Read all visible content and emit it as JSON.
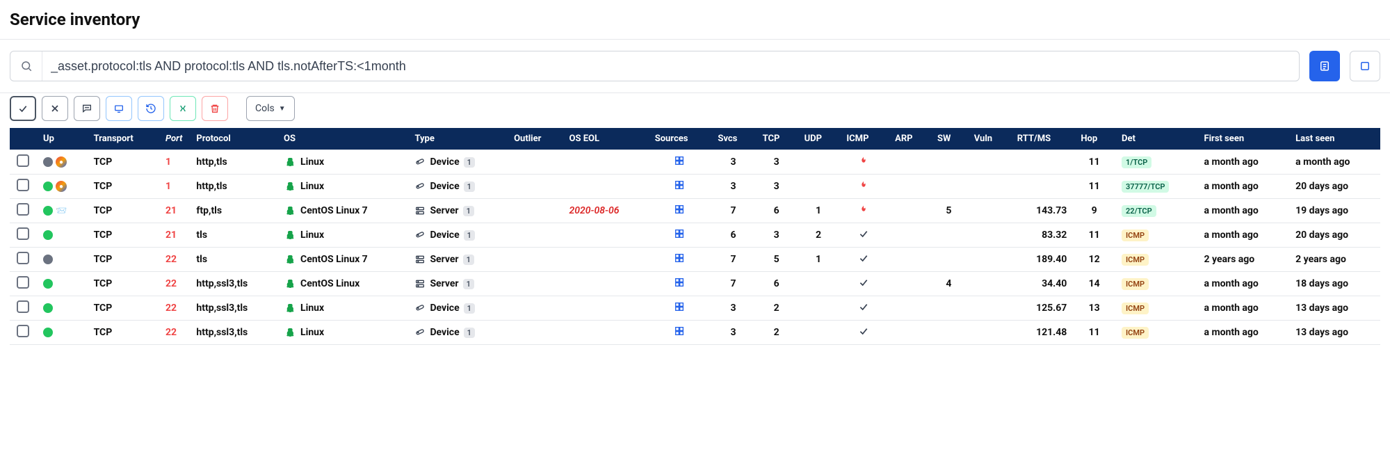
{
  "page": {
    "title": "Service inventory"
  },
  "search": {
    "value": "_asset.protocol:tls AND protocol:tls AND tls.notAfterTS:<1month"
  },
  "toolbar": {
    "cols_label": "Cols"
  },
  "columns": {
    "up": "Up",
    "transport": "Transport",
    "port": "Port",
    "protocol": "Protocol",
    "os": "OS",
    "type": "Type",
    "outlier": "Outlier",
    "os_eol": "OS EOL",
    "sources": "Sources",
    "svcs": "Svcs",
    "tcp": "TCP",
    "udp": "UDP",
    "icmp": "ICMP",
    "arp": "ARP",
    "sw": "SW",
    "vuln": "Vuln",
    "rtt": "RTT/MS",
    "hop": "Hop",
    "det": "Det",
    "first_seen": "First seen",
    "last_seen": "Last seen"
  },
  "rows": [
    {
      "up": "gray",
      "pair": "browser",
      "transport": "TCP",
      "port": "1",
      "protocol": "http,tls",
      "os": "Linux",
      "type": "Device",
      "type_n": "1",
      "outlier": "",
      "eol": "",
      "svcs": "3",
      "tcp": "3",
      "udp": "",
      "icmp": "flame",
      "arp": "",
      "sw": "",
      "vuln": "",
      "rtt": "",
      "hop": "11",
      "det": "1/TCP",
      "det_style": "tcp",
      "first": "a month ago",
      "last": "a month ago"
    },
    {
      "up": "green",
      "pair": "browser",
      "transport": "TCP",
      "port": "1",
      "protocol": "http,tls",
      "os": "Linux",
      "type": "Device",
      "type_n": "1",
      "outlier": "",
      "eol": "",
      "svcs": "3",
      "tcp": "3",
      "udp": "",
      "icmp": "flame",
      "arp": "",
      "sw": "",
      "vuln": "",
      "rtt": "",
      "hop": "11",
      "det": "37777/TCP",
      "det_style": "tcp",
      "first": "a month ago",
      "last": "20 days ago"
    },
    {
      "up": "green",
      "pair": "envelope",
      "transport": "TCP",
      "port": "21",
      "protocol": "ftp,tls",
      "os": "CentOS Linux 7",
      "type": "Server",
      "type_n": "1",
      "outlier": "",
      "eol": "2020-08-06",
      "svcs": "7",
      "tcp": "6",
      "udp": "1",
      "icmp": "flame",
      "arp": "",
      "sw": "5",
      "vuln": "",
      "rtt": "143.73",
      "hop": "9",
      "det": "22/TCP",
      "det_style": "tcp",
      "first": "a month ago",
      "last": "19 days ago"
    },
    {
      "up": "green",
      "pair": "",
      "transport": "TCP",
      "port": "21",
      "protocol": "tls",
      "os": "Linux",
      "type": "Device",
      "type_n": "1",
      "outlier": "",
      "eol": "",
      "svcs": "6",
      "tcp": "3",
      "udp": "2",
      "icmp": "check",
      "arp": "",
      "sw": "",
      "vuln": "",
      "rtt": "83.32",
      "hop": "11",
      "det": "ICMP",
      "det_style": "icmp",
      "first": "a month ago",
      "last": "20 days ago"
    },
    {
      "up": "gray",
      "pair": "",
      "transport": "TCP",
      "port": "22",
      "protocol": "tls",
      "os": "CentOS Linux 7",
      "type": "Server",
      "type_n": "1",
      "outlier": "",
      "eol": "",
      "svcs": "7",
      "tcp": "5",
      "udp": "1",
      "icmp": "check",
      "arp": "",
      "sw": "",
      "vuln": "",
      "rtt": "189.40",
      "hop": "12",
      "det": "ICMP",
      "det_style": "icmp",
      "first": "2 years ago",
      "last": "2 years ago"
    },
    {
      "up": "green",
      "pair": "",
      "transport": "TCP",
      "port": "22",
      "protocol": "http,ssl3,tls",
      "os": "CentOS Linux",
      "type": "Server",
      "type_n": "1",
      "outlier": "",
      "eol": "",
      "svcs": "7",
      "tcp": "6",
      "udp": "",
      "icmp": "check",
      "arp": "",
      "sw": "4",
      "vuln": "",
      "rtt": "34.40",
      "hop": "14",
      "det": "ICMP",
      "det_style": "icmp",
      "first": "a month ago",
      "last": "18 days ago"
    },
    {
      "up": "green",
      "pair": "",
      "transport": "TCP",
      "port": "22",
      "protocol": "http,ssl3,tls",
      "os": "Linux",
      "type": "Device",
      "type_n": "1",
      "outlier": "",
      "eol": "",
      "svcs": "3",
      "tcp": "2",
      "udp": "",
      "icmp": "check",
      "arp": "",
      "sw": "",
      "vuln": "",
      "rtt": "125.67",
      "hop": "13",
      "det": "ICMP",
      "det_style": "icmp",
      "first": "a month ago",
      "last": "13 days ago"
    },
    {
      "up": "green",
      "pair": "",
      "transport": "TCP",
      "port": "22",
      "protocol": "http,ssl3,tls",
      "os": "Linux",
      "type": "Device",
      "type_n": "1",
      "outlier": "",
      "eol": "",
      "svcs": "3",
      "tcp": "2",
      "udp": "",
      "icmp": "check",
      "arp": "",
      "sw": "",
      "vuln": "",
      "rtt": "121.48",
      "hop": "11",
      "det": "ICMP",
      "det_style": "icmp",
      "first": "a month ago",
      "last": "13 days ago"
    }
  ]
}
